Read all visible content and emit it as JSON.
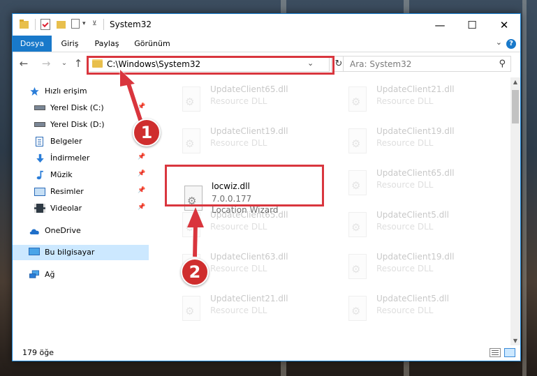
{
  "window": {
    "title": "System32",
    "controls": {
      "minimize": "—",
      "maximize": "☐",
      "close": "✕"
    }
  },
  "ribbon": {
    "tabs": [
      "Dosya",
      "Giriş",
      "Paylaş",
      "Görünüm"
    ],
    "collapse_glyph": "⌄",
    "help_glyph": "?"
  },
  "nav": {
    "back": "←",
    "forward": "→",
    "recent": "⌄",
    "up": "↑",
    "address_path": "C:\\Windows\\System32",
    "address_dropdown": "⌄",
    "refresh": "↻",
    "search_placeholder": "Ara: System32",
    "search_glyph": "⚲"
  },
  "sidebar": {
    "items": [
      {
        "label": "Hızlı erişim",
        "icon": "star-icon",
        "pinned": false
      },
      {
        "label": "Yerel Disk (C:)",
        "icon": "drive-icon",
        "pinned": true
      },
      {
        "label": "Yerel Disk (D:)",
        "icon": "drive-icon",
        "pinned": false
      },
      {
        "label": "Belgeler",
        "icon": "documents-icon",
        "pinned": true
      },
      {
        "label": "İndirmeler",
        "icon": "download-icon",
        "pinned": true
      },
      {
        "label": "Müzik",
        "icon": "music-icon",
        "pinned": true
      },
      {
        "label": "Resimler",
        "icon": "pictures-icon",
        "pinned": true
      },
      {
        "label": "Videolar",
        "icon": "videos-icon",
        "pinned": true
      },
      {
        "label": "OneDrive",
        "icon": "cloud-icon",
        "pinned": false
      },
      {
        "label": "Bu bilgisayar",
        "icon": "computer-icon",
        "pinned": false,
        "selected": true
      },
      {
        "label": "Ağ",
        "icon": "network-icon",
        "pinned": false
      }
    ],
    "pin_glyph": "📌"
  },
  "files": {
    "sub_label": "Resource DLL",
    "left_column": [
      "UpdateClient65.dll",
      "UpdateClient19.dll",
      "UpdateClient65.dll",
      "UpdateClient63.dll",
      "UpdateClient21.dll"
    ],
    "right_column": [
      "UpdateClient21.dll",
      "UpdateClient19.dll",
      "UpdateClient65.dll",
      "UpdateClient5.dll",
      "UpdateClient19.dll",
      "UpdateClient5.dll"
    ],
    "highlighted": {
      "name": "locwiz.dll",
      "version": "7.0.0.177",
      "description": "Location Wizard"
    },
    "gear_glyph": "⚙"
  },
  "status": {
    "item_count": "179 öğe"
  },
  "annotations": {
    "step1": "1",
    "step2": "2",
    "color": "#d9363e"
  }
}
